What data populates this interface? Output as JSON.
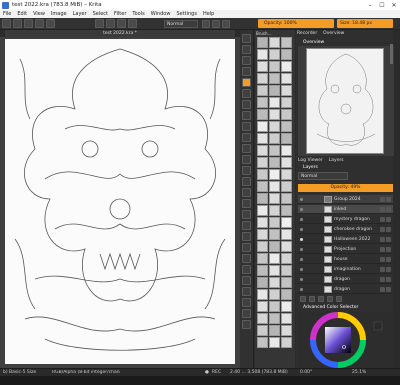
{
  "window": {
    "title": "test 2022.kra (783.8 MiB) – Krita"
  },
  "menu": [
    "File",
    "Edit",
    "View",
    "Image",
    "Layer",
    "Select",
    "Filter",
    "Tools",
    "Window",
    "Settings",
    "Help"
  ],
  "toolbar": {
    "blend_mode": "Normal",
    "opacity": "Opacity: 100%",
    "size": "Size: 18.48 px"
  },
  "document": {
    "tab": "test 2022.kra *"
  },
  "brushes": {
    "title": "Brush…",
    "filter_label": "Filter in Tag"
  },
  "right_tabs": [
    "Recorder",
    "Overview"
  ],
  "overview_label": "Overview",
  "layers": {
    "tabs": [
      "Log Viewer",
      "Layers"
    ],
    "label": "Layers",
    "blend": "Normal",
    "opacity": "Opacity: 49%",
    "items": [
      "Group 2024",
      "inked",
      "mystery dragon",
      "cherokee dragon",
      "Halloween 2022",
      "Projection",
      "house",
      "imagination",
      "dragon",
      "dragon"
    ]
  },
  "color_selector": {
    "label": "Advanced Color Selector"
  },
  "status": {
    "brush": "b) Basic-5 Size",
    "color": "RGB/Alpha (8-bit integer/channel) sRGB (1998)",
    "rec": "REC",
    "dims": "2.40 … 3,508 (783.8 MiB)",
    "angle": "0.00°",
    "zoom": "25.1%"
  },
  "colors": {
    "accent": "#f39c26",
    "panel": "#2f2f2f",
    "dark": "#2b2b2b"
  }
}
